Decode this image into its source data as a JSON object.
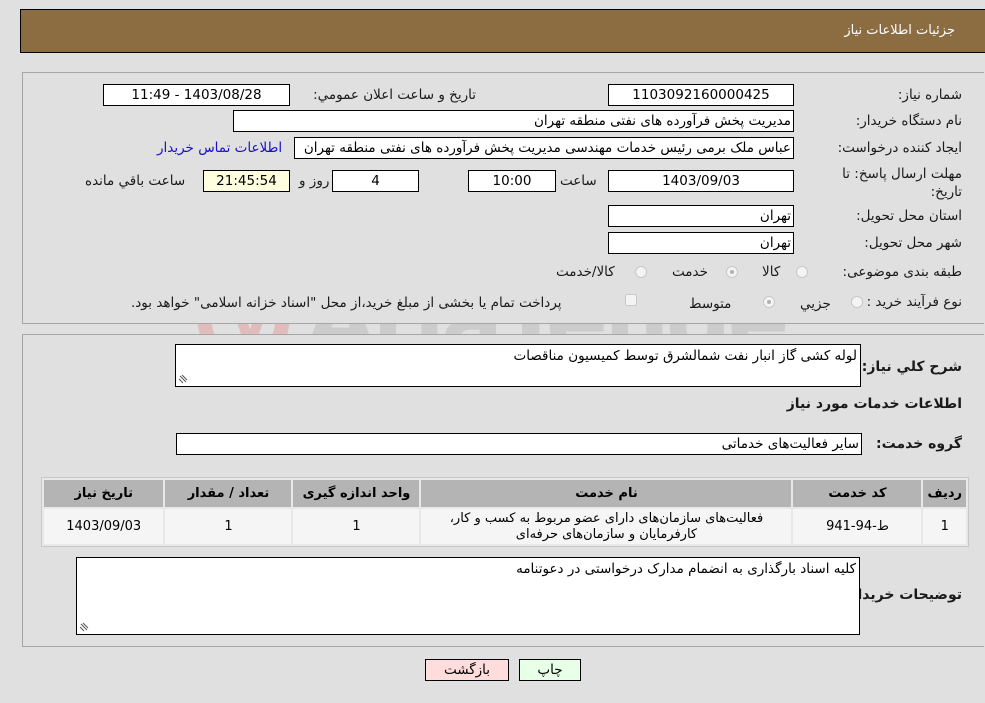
{
  "header": {
    "title": "جزئیات اطلاعات نیاز"
  },
  "details": {
    "need_number": {
      "label": "شماره نیاز:",
      "value": "1103092160000425"
    },
    "announce_datetime": {
      "label": "تاريخ و ساعت اعلان عمومي:",
      "value": "1403/08/28 - 11:49"
    },
    "buyer_org": {
      "label": "نام دستگاه خريدار:",
      "value": "مدیریت پخش فرآورده های نفتی منطقه تهران"
    },
    "requester": {
      "label": "ايجاد كننده درخواست:",
      "value": "عباس ملک برمی رئیس خدمات مهندسی مدیریت پخش فرآورده های نفتی منطقه تهران",
      "contact_link": "اطلاعات تماس خريدار"
    },
    "deadline": {
      "label": "مهلت ارسال پاسخ: تا تاريخ:",
      "date": "1403/09/03",
      "time_label": "ساعت",
      "time": "10:00",
      "days": "4",
      "days_label": "روز و",
      "remaining": "21:45:54",
      "remaining_label": "ساعت باقي مانده"
    },
    "province": {
      "label": "استان محل تحويل:",
      "value": "تهران"
    },
    "city": {
      "label": "شهر محل تحويل:",
      "value": "تهران"
    },
    "category": {
      "label": "طبقه بندی موضوعی:",
      "options": [
        "کالا",
        "خدمت",
        "کالا/خدمت"
      ],
      "selected": "خدمت"
    },
    "purchase_type": {
      "label": "نوع فرآیند خرید :",
      "options": [
        "جزيي",
        "متوسط"
      ],
      "selected": "متوسط",
      "treasury_note": "پرداخت تمام یا بخشی از مبلغ خرید،از محل \"اسناد خزانه اسلامی\" خواهد بود."
    }
  },
  "description": {
    "label": "شرح كلي نياز:",
    "value": "لوله کشی گاز انبار نفت شمالشرق توسط کمیسیون مناقصات"
  },
  "services_section": {
    "title": "اطلاعات خدمات مورد نياز"
  },
  "service_group": {
    "label": "گروه خدمت:",
    "value": "سایر فعالیت‌های خدماتی"
  },
  "services_table": {
    "columns": [
      "رديف",
      "کد خدمت",
      "نام خدمت",
      "واحد اندازه گیری",
      "تعداد / مقدار",
      "تاريخ نياز"
    ],
    "rows": [
      [
        "1",
        "ط-94-941",
        "فعالیت‌های سازمان‌های دارای عضو مربوط به کسب و کار، کارفرمایان و سازمان‌های حرفه‌ای",
        "1",
        "1",
        "1403/09/03"
      ]
    ]
  },
  "buyer_notes": {
    "label": "توضيحات خريدار:",
    "value": "کلیه اسناد بارگذاری به انضمام مدارک درخواستی در دعوتنامه"
  },
  "buttons": {
    "print": "چاپ",
    "back": "بازگشت"
  },
  "watermark": {
    "text": "AriaTender.neT"
  }
}
